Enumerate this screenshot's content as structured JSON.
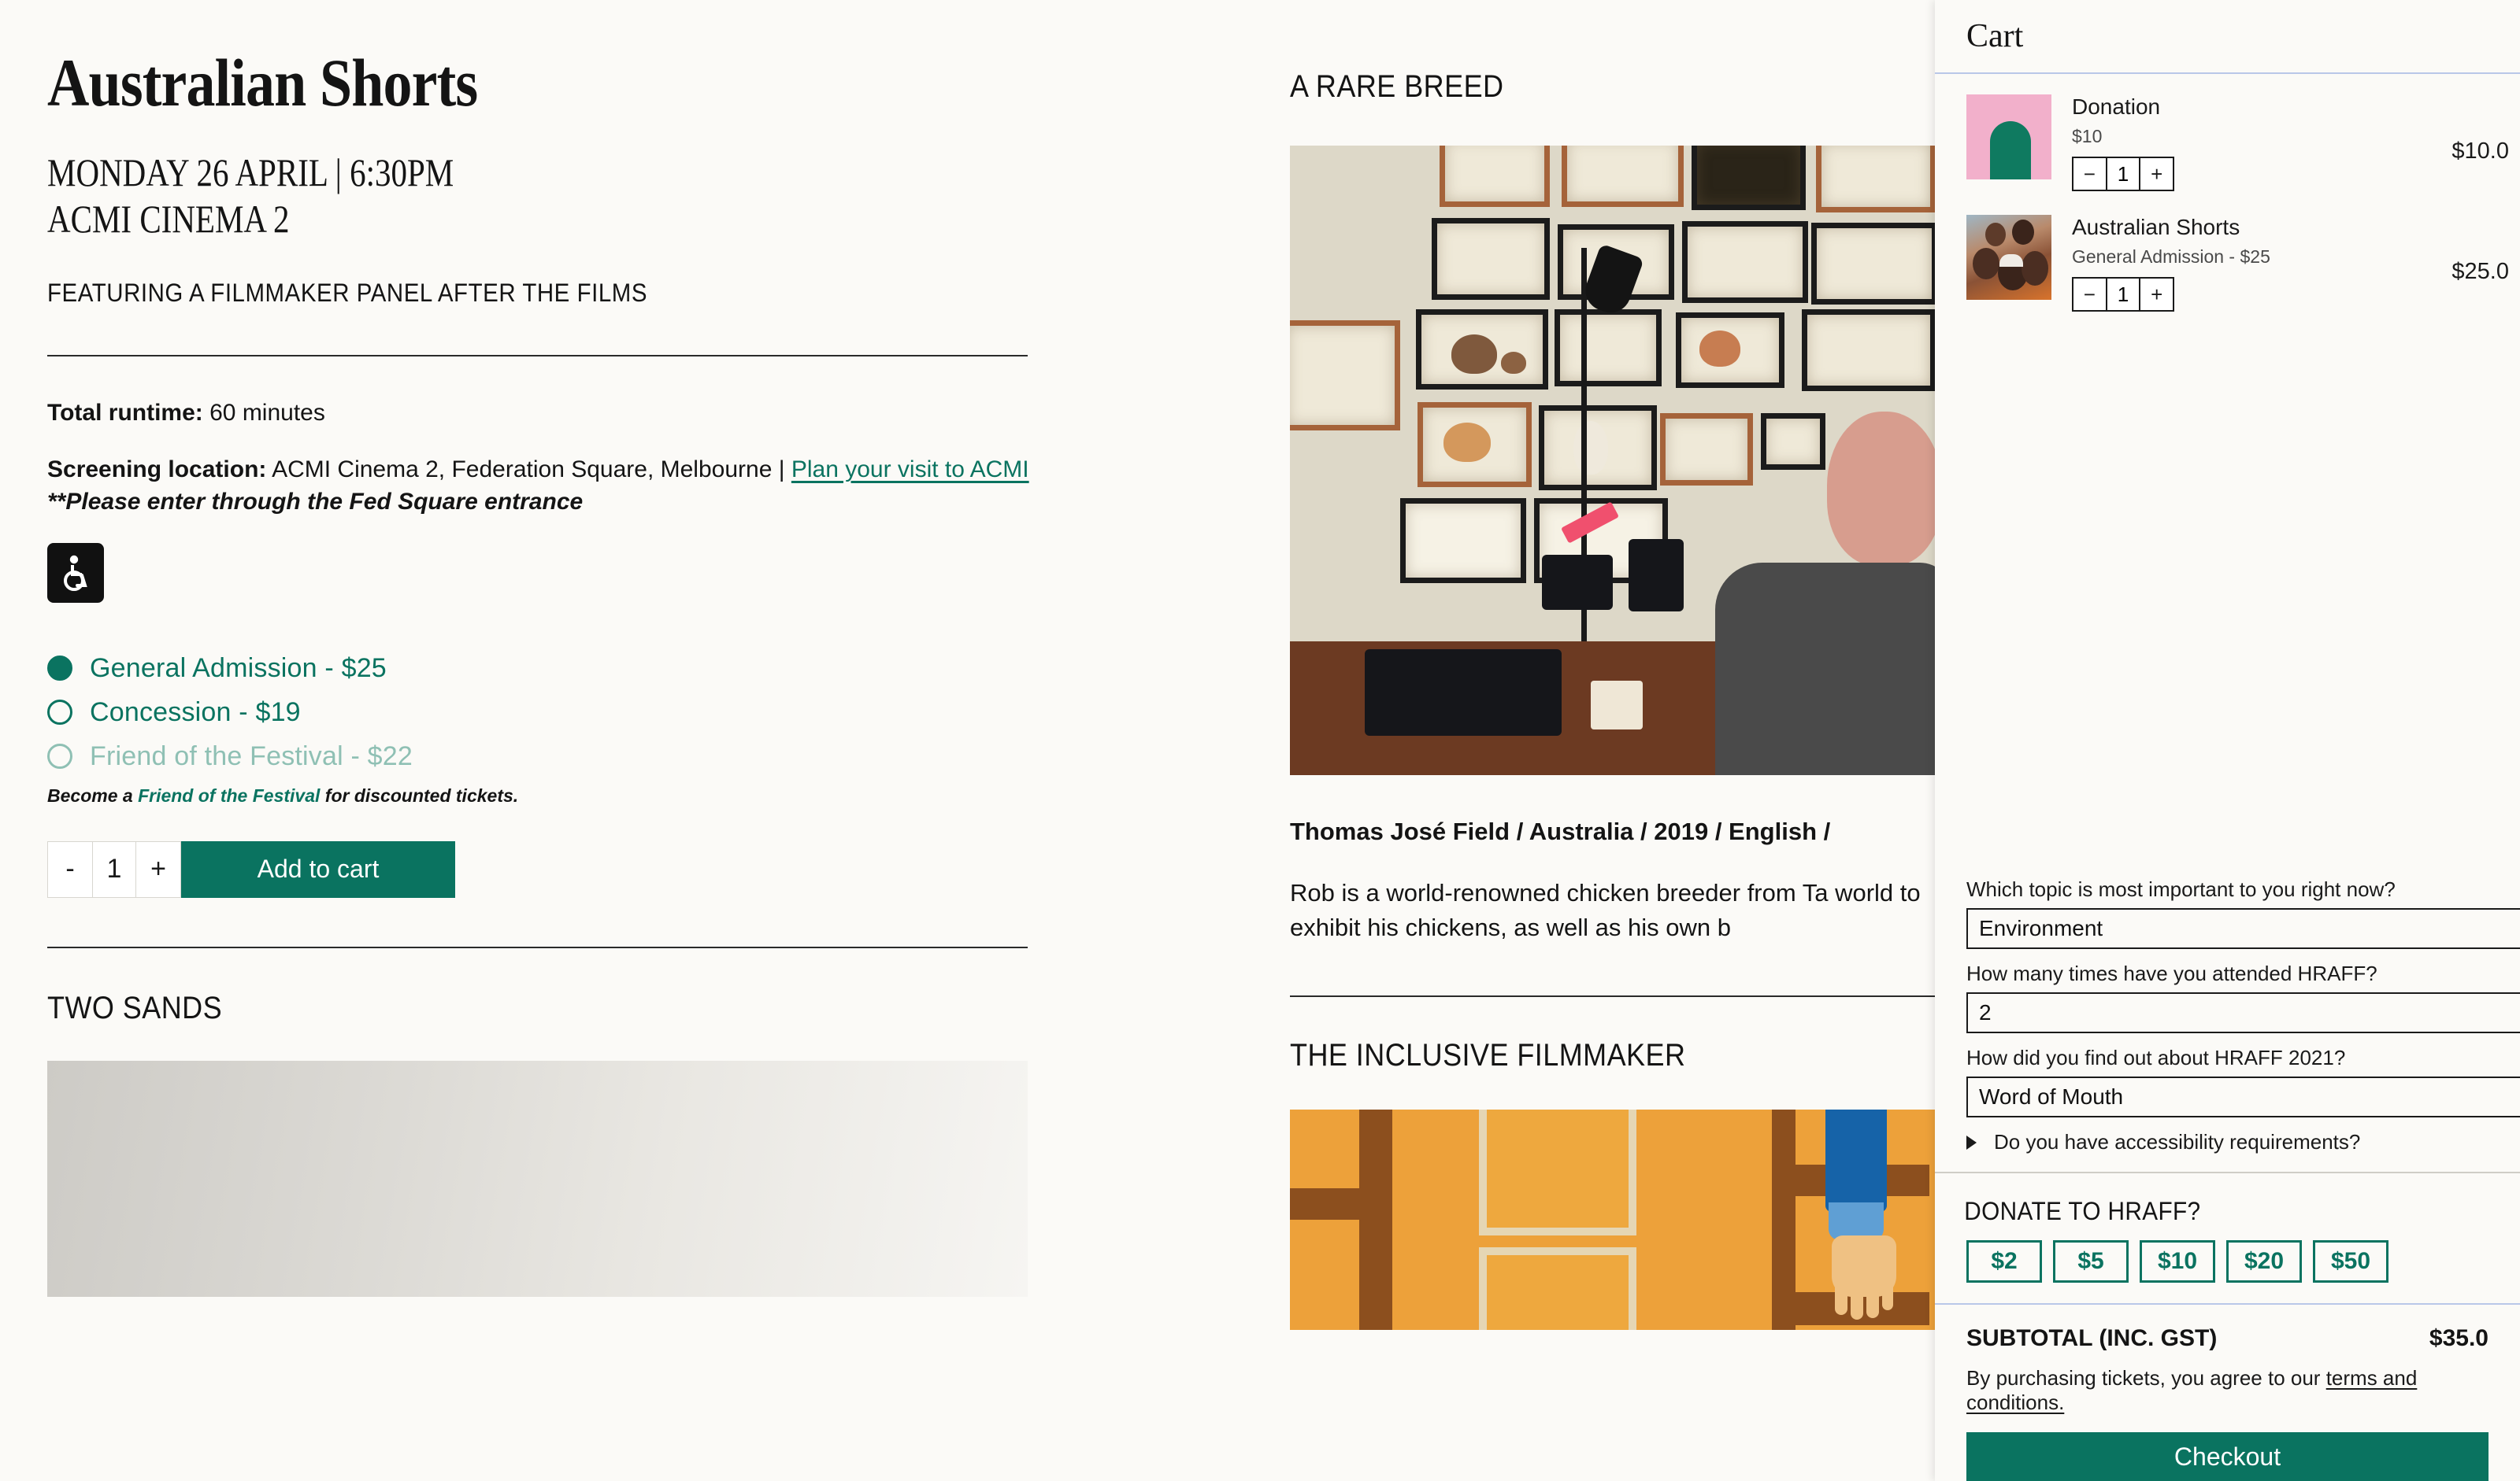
{
  "event": {
    "title": "Australian Shorts",
    "when_line1": "MONDAY 26 APRIL | 6:30PM",
    "when_line2": "ACMI CINEMA 2",
    "feature_note": "FEATURING A FILMMAKER PANEL AFTER THE FILMS",
    "runtime_label": "Total runtime:",
    "runtime_value": " 60 minutes",
    "location_label": "Screening location:",
    "location_value": " ACMI Cinema 2, Federation Square, Melbourne | ",
    "location_link": "Plan your visit to ACMI",
    "location_note": "**Please enter through the Fed Square entrance",
    "accessibility_icon": "wheelchair-icon"
  },
  "ticket_options": [
    {
      "label": "General Admission - $25",
      "selected": true,
      "dimmed": false
    },
    {
      "label": "Concession - $19",
      "selected": false,
      "dimmed": false
    },
    {
      "label": "Friend of the Festival - $22",
      "selected": false,
      "dimmed": true
    }
  ],
  "ticket_note_prefix": "Become a ",
  "ticket_note_link": "Friend of the Festival",
  "ticket_note_suffix": " for discounted tickets.",
  "add_to_cart": {
    "minus": "-",
    "quantity": "1",
    "plus": "+",
    "label": "Add to cart"
  },
  "films": [
    {
      "title": "A RARE BREED",
      "credit": "Thomas José Field / Australia / 2019 / English / ",
      "desc": "Rob is a world-renowned chicken breeder from Ta\nworld to exhibit his chickens, as well as his own b"
    },
    {
      "title": "THE INCLUSIVE FILMMAKER"
    },
    {
      "title": "TWO SANDS"
    }
  ],
  "cart": {
    "title": "Cart",
    "items": [
      {
        "name": "Donation",
        "sub": "$10",
        "thumb": "donation-thumb",
        "minus": "−",
        "quantity": "1",
        "plus": "+",
        "price": "$10.0"
      },
      {
        "name": "Australian Shorts",
        "sub": "General Admission - $25",
        "thumb": "australian-shorts-thumb",
        "minus": "−",
        "quantity": "1",
        "plus": "+",
        "price": "$25.0"
      }
    ],
    "questions": [
      {
        "label": "Which topic is most important to you right now?",
        "value": "Environment"
      },
      {
        "label": "How many times have you attended HRAFF?",
        "value": "2"
      },
      {
        "label": "How did you find out about HRAFF 2021?",
        "value": "Word of Mouth"
      }
    ],
    "accessibility_accordion": "Do you have accessibility requirements?",
    "donate_title": "DONATE TO HRAFF?",
    "donate_amounts": [
      "$2",
      "$5",
      "$10",
      "$20",
      "$50"
    ],
    "subtotal_label": "SUBTOTAL (INC. GST)",
    "subtotal_value": "$35.0",
    "terms_prefix": "By purchasing tickets, you agree to our ",
    "terms_link": "terms and conditions.",
    "checkout_label": "Checkout"
  },
  "colors": {
    "brand_green": "#0a7360",
    "page_bg": "#fbfaf7",
    "divider_blue": "#b9c7e8",
    "pink_thumb": "#f2b0cb"
  }
}
